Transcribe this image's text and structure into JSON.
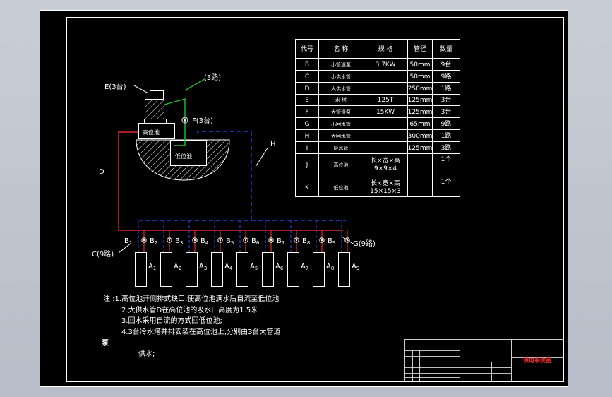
{
  "labels": {
    "E": "E(3台)",
    "I": "I(3路)",
    "F": "F(3台)",
    "gaowei": "高位池",
    "diwei": "低位池",
    "H": "H",
    "D": "D",
    "C": "C(9路)",
    "G": "G(9路)",
    "pumps": [
      "B1",
      "B2",
      "B3",
      "B4",
      "B5",
      "B6",
      "B7",
      "B8",
      "B9"
    ],
    "machines": [
      "A1",
      "A2",
      "A3",
      "A4",
      "A5",
      "A6",
      "A7",
      "A8",
      "A9"
    ]
  },
  "table": {
    "headers": [
      "代号",
      "名 称",
      "规 格",
      "管径",
      "数量"
    ],
    "rows": [
      [
        "B",
        "小管道泵",
        "3.7KW",
        "50mm",
        "9台"
      ],
      [
        "C",
        "小供水管",
        "",
        "50mm",
        "9路"
      ],
      [
        "D",
        "大供水管",
        "",
        "250mm",
        "1路"
      ],
      [
        "E",
        "水 塔",
        "125T",
        "125mm",
        "3台"
      ],
      [
        "F",
        "大管道泵",
        "15KW",
        "125mm",
        "3台"
      ],
      [
        "G",
        "小回水管",
        "",
        "65mm",
        "9路"
      ],
      [
        "H",
        "大回水管",
        "",
        "300mm",
        "1路"
      ],
      [
        "I",
        "吸水管",
        "",
        "125mm",
        "3路"
      ],
      [
        "J",
        "高位池",
        "长×宽×高\n9×9×4",
        "",
        "1个"
      ],
      [
        "K",
        "低位池",
        "长×宽×高\n15×15×3",
        "",
        "1个"
      ]
    ]
  },
  "notes": [
    "注 :1.高位池开侧排式缺口,使高位池满水后自流至低位池",
    "2.大供水管D在高位池的吸水口高度为1.5米",
    "3.回水采用自流的方式回低位池;",
    "4.3台冷水塔并排安装在高位池上,分别由3台大管道",
    "泵",
    "供水;"
  ],
  "title_block": {
    "title": "供电系统图"
  },
  "colors": {
    "supply": "#e0282f",
    "return": "#2a3fd6",
    "suction": "#21c12a",
    "line": "#ffffff",
    "title": "#ff3030"
  }
}
